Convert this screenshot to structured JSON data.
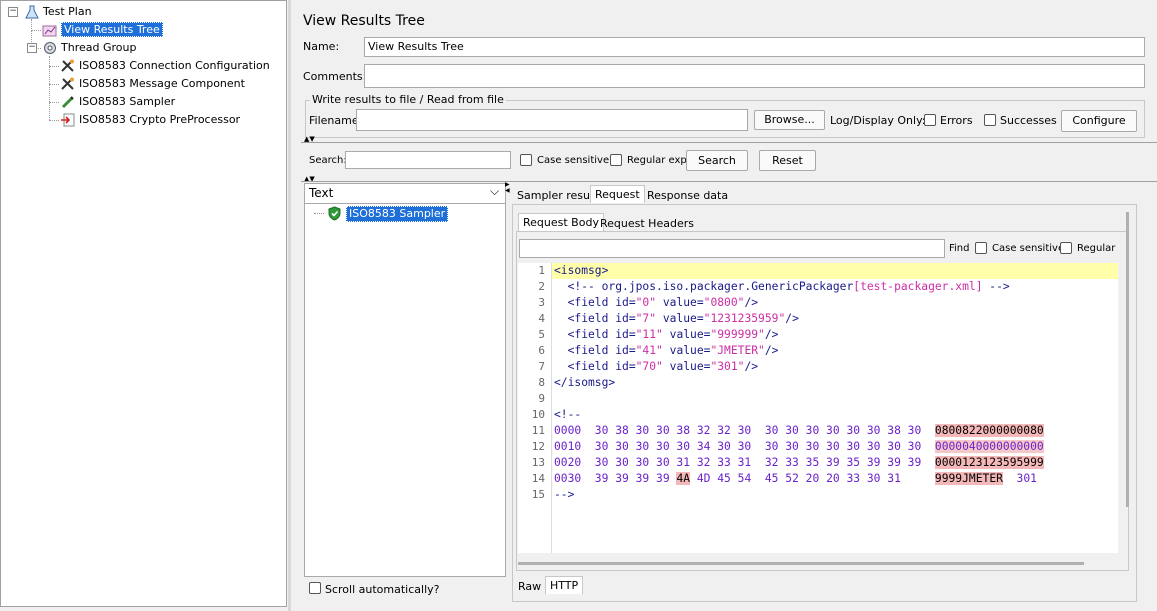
{
  "tree": {
    "items": [
      {
        "label": "Test Plan",
        "icon": "flask-icon"
      },
      {
        "label": "View Results Tree",
        "icon": "chart-icon"
      },
      {
        "label": "Thread Group",
        "icon": "gear-icon"
      },
      {
        "label": "ISO8583 Connection Configuration",
        "icon": "wrench-icon"
      },
      {
        "label": "ISO8583 Message Component",
        "icon": "wrench-icon"
      },
      {
        "label": "ISO8583 Sampler",
        "icon": "pipette-icon"
      },
      {
        "label": "ISO8583 Crypto PreProcessor",
        "icon": "document-arrow-icon"
      }
    ]
  },
  "panel": {
    "title": "View Results Tree",
    "name_label": "Name:",
    "name_value": "View Results Tree",
    "comments_label": "Comments:",
    "comments_value": "",
    "file_group_title": "Write results to file / Read from file",
    "filename_label": "Filename",
    "filename_value": "",
    "browse_label": "Browse...",
    "log_display_label": "Log/Display Only:",
    "errors_label": "Errors",
    "successes_label": "Successes",
    "configure_label": "Configure"
  },
  "search": {
    "label": "Search:",
    "value": "",
    "case_sensitive_label": "Case sensitive",
    "regular_exp_label": "Regular exp.",
    "search_button": "Search",
    "reset_button": "Reset"
  },
  "results": {
    "renderer_selected": "Text",
    "sample_label": "ISO8583 Sampler",
    "scroll_auto_label": "Scroll automatically?"
  },
  "tabs": {
    "main": [
      "Sampler result",
      "Request",
      "Response data"
    ],
    "sub": [
      "Request Body",
      "Request Headers"
    ],
    "bottom": [
      "Raw",
      "HTTP"
    ]
  },
  "find": {
    "value": "",
    "find_label": "Find",
    "case_sensitive_label": "Case sensitive",
    "regular_label": "Regular ex"
  },
  "code": {
    "line_numbers": [
      "1",
      "2",
      "3",
      "4",
      "5",
      "6",
      "7",
      "8",
      "9",
      "10",
      "11",
      "12",
      "13",
      "14",
      "15"
    ],
    "l1": "<isomsg>",
    "l2_a": "  <!-- org.jpos.iso.packager.GenericPackager",
    "l2_b": "[test-packager.xml]",
    "l2_c": " -->",
    "l3_id": "\"0\"",
    "l3_val": "\"0800\"",
    "l4_id": "\"7\"",
    "l4_val": "\"1231235959\"",
    "l5_id": "\"11\"",
    "l5_val": "\"999999\"",
    "l6_id": "\"41\"",
    "l6_val": "\"JMETER\"",
    "l7_id": "\"70\"",
    "l7_val": "\"301\"",
    "field_open": "  <field id=",
    "value_attr": " value=",
    "field_close": "/>",
    "l8": "</isomsg>",
    "l10": "<!--",
    "l11_hex": "0000  30 38 30 30 38 32 32 30  30 30 30 30 30 30 38 30",
    "l11_ascii": "0800822000000080",
    "l12_hex": "0010  30 30 30 30 30 34 30 30  30 30 30 30 30 30 30 30",
    "l12_ascii": "0000040000000000",
    "l13_hex": "0020  30 30 30 30 31 32 33 31  32 33 35 39 35 39 39 39",
    "l13_ascii": "0000123123595999",
    "l14_hex_a": "0030  39 39 39 39 ",
    "l14_hex_hl": "4A",
    "l14_hex_b": " 4D 45 54  45 52 20 20 33 30 31",
    "l14_ascii_a": "9999JMETER",
    "l14_ascii_b": "  301",
    "l15": "-->"
  }
}
